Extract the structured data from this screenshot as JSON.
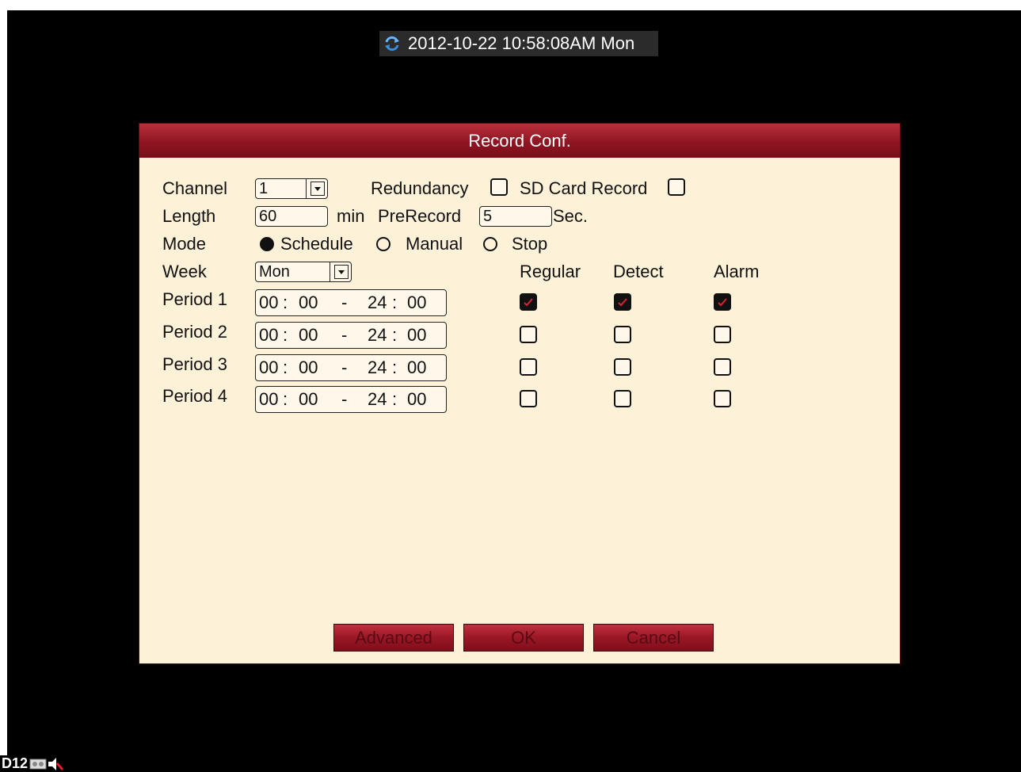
{
  "clock": {
    "datetime": "2012-10-22 10:58:08AM Mon",
    "icon": "refresh-icon"
  },
  "dialog": {
    "title": "Record Conf.",
    "channel": {
      "label": "Channel",
      "value": "1"
    },
    "redundancy": {
      "label": "Redundancy",
      "checked": false
    },
    "sd_card_record": {
      "label": "SD Card Record",
      "checked": false
    },
    "length": {
      "label": "Length",
      "value": "60",
      "unit": "min"
    },
    "prerecord": {
      "label": "PreRecord",
      "value": "5",
      "unit": "Sec."
    },
    "mode": {
      "label": "Mode",
      "options": [
        "Schedule",
        "Manual",
        "Stop"
      ],
      "selected": "Schedule"
    },
    "week": {
      "label": "Week",
      "value": "Mon"
    },
    "columns": [
      "Regular",
      "Detect",
      "Alarm"
    ],
    "periods": [
      {
        "label": "Period 1",
        "start_h": "00",
        "start_m": "00",
        "dash": "-",
        "end_h": "24",
        "end_m": "00",
        "regular": true,
        "detect": true,
        "alarm": true
      },
      {
        "label": "Period 2",
        "start_h": "00",
        "start_m": "00",
        "dash": "-",
        "end_h": "24",
        "end_m": "00",
        "regular": false,
        "detect": false,
        "alarm": false
      },
      {
        "label": "Period 3",
        "start_h": "00",
        "start_m": "00",
        "dash": "-",
        "end_h": "24",
        "end_m": "00",
        "regular": false,
        "detect": false,
        "alarm": false
      },
      {
        "label": "Period 4",
        "start_h": "00",
        "start_m": "00",
        "dash": "-",
        "end_h": "24",
        "end_m": "00",
        "regular": false,
        "detect": false,
        "alarm": false
      }
    ],
    "buttons": {
      "advanced": "Advanced",
      "ok": "OK",
      "cancel": "Cancel"
    }
  },
  "status": {
    "label": "D12",
    "icons": [
      "hdd-icon",
      "speaker-muted-icon"
    ]
  },
  "colors": {
    "title_bar": "#8f1522",
    "dialog_bg": "#fdf1d8",
    "check_mark": "#e02030"
  }
}
